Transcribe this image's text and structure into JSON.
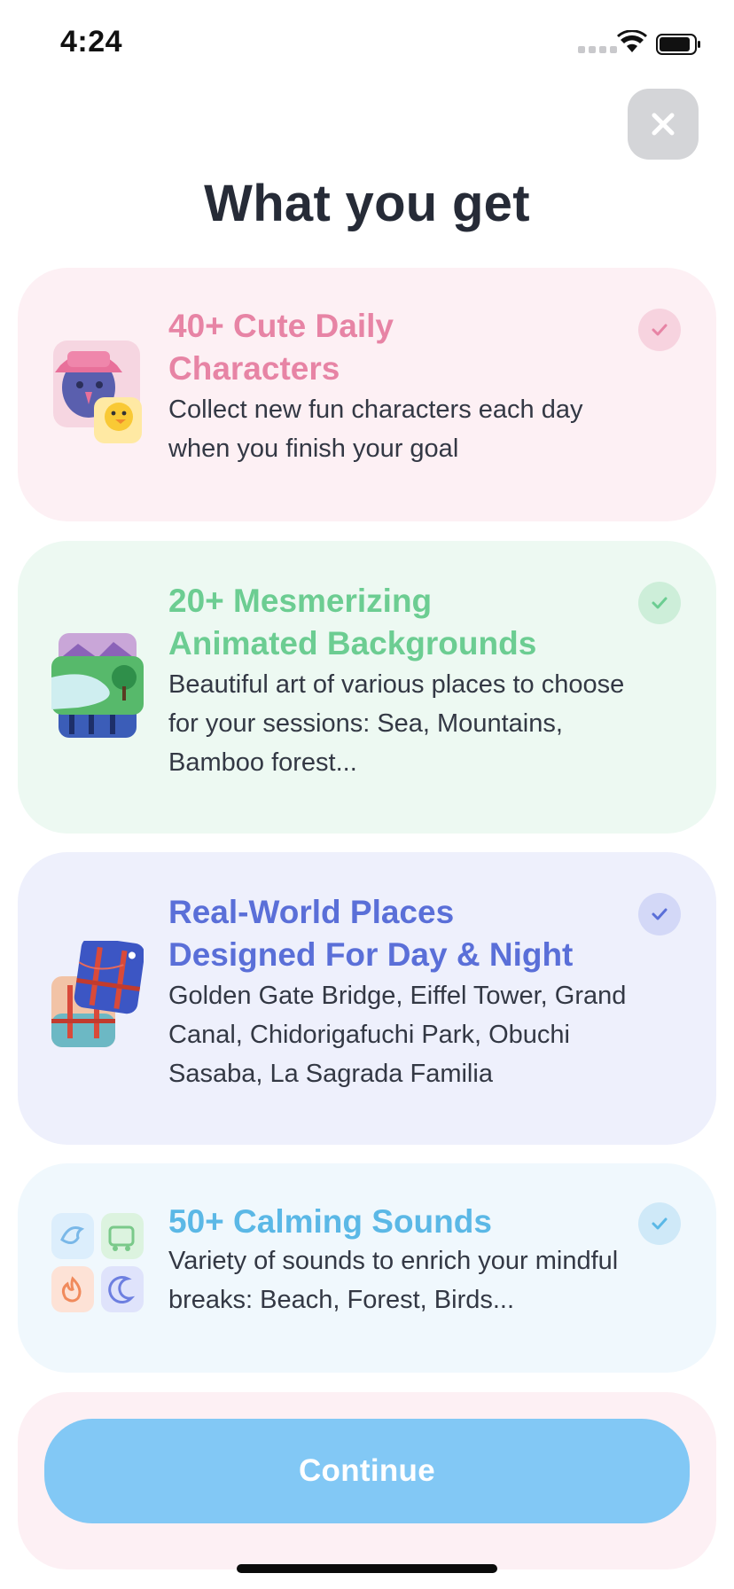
{
  "status_bar": {
    "time": "4:24"
  },
  "header": {
    "title": "What you get",
    "close_icon": "close-icon"
  },
  "features": [
    {
      "title_line1": "40+ Cute Daily",
      "title_line2": "Characters",
      "desc_line1": "Collect new fun characters each day",
      "desc_line2": "when you finish your goal",
      "accent": "#e784a5",
      "icon": "characters-icon"
    },
    {
      "title_line1": "20+ Mesmerizing",
      "title_line2": "Animated Backgrounds",
      "desc_line1": "Beautiful art of various places to choose",
      "desc_line2": "for your sessions: Sea, Mountains,",
      "desc_line3": "Bamboo forest...",
      "accent": "#6ccd92",
      "icon": "backgrounds-icon"
    },
    {
      "title_line1": "Real-World Places",
      "title_line2": "Designed For Day & Night",
      "desc_line1": "Golden Gate Bridge, Eiffel Tower, Grand",
      "desc_line2": "Canal, Chidorigafuchi Park, Obuchi",
      "desc_line3": "Sasaba, La Sagrada Familia",
      "accent": "#5a6fd8",
      "icon": "places-icon"
    },
    {
      "title_line1": "50+ Calming Sounds",
      "desc_line1": "Variety of sounds to enrich your mindful",
      "desc_line2": "breaks: Beach, Forest, Birds...",
      "accent": "#5bb8e6",
      "icon": "sounds-icon"
    }
  ],
  "footer": {
    "continue_label": "Continue",
    "button_color": "#82c8f5"
  }
}
